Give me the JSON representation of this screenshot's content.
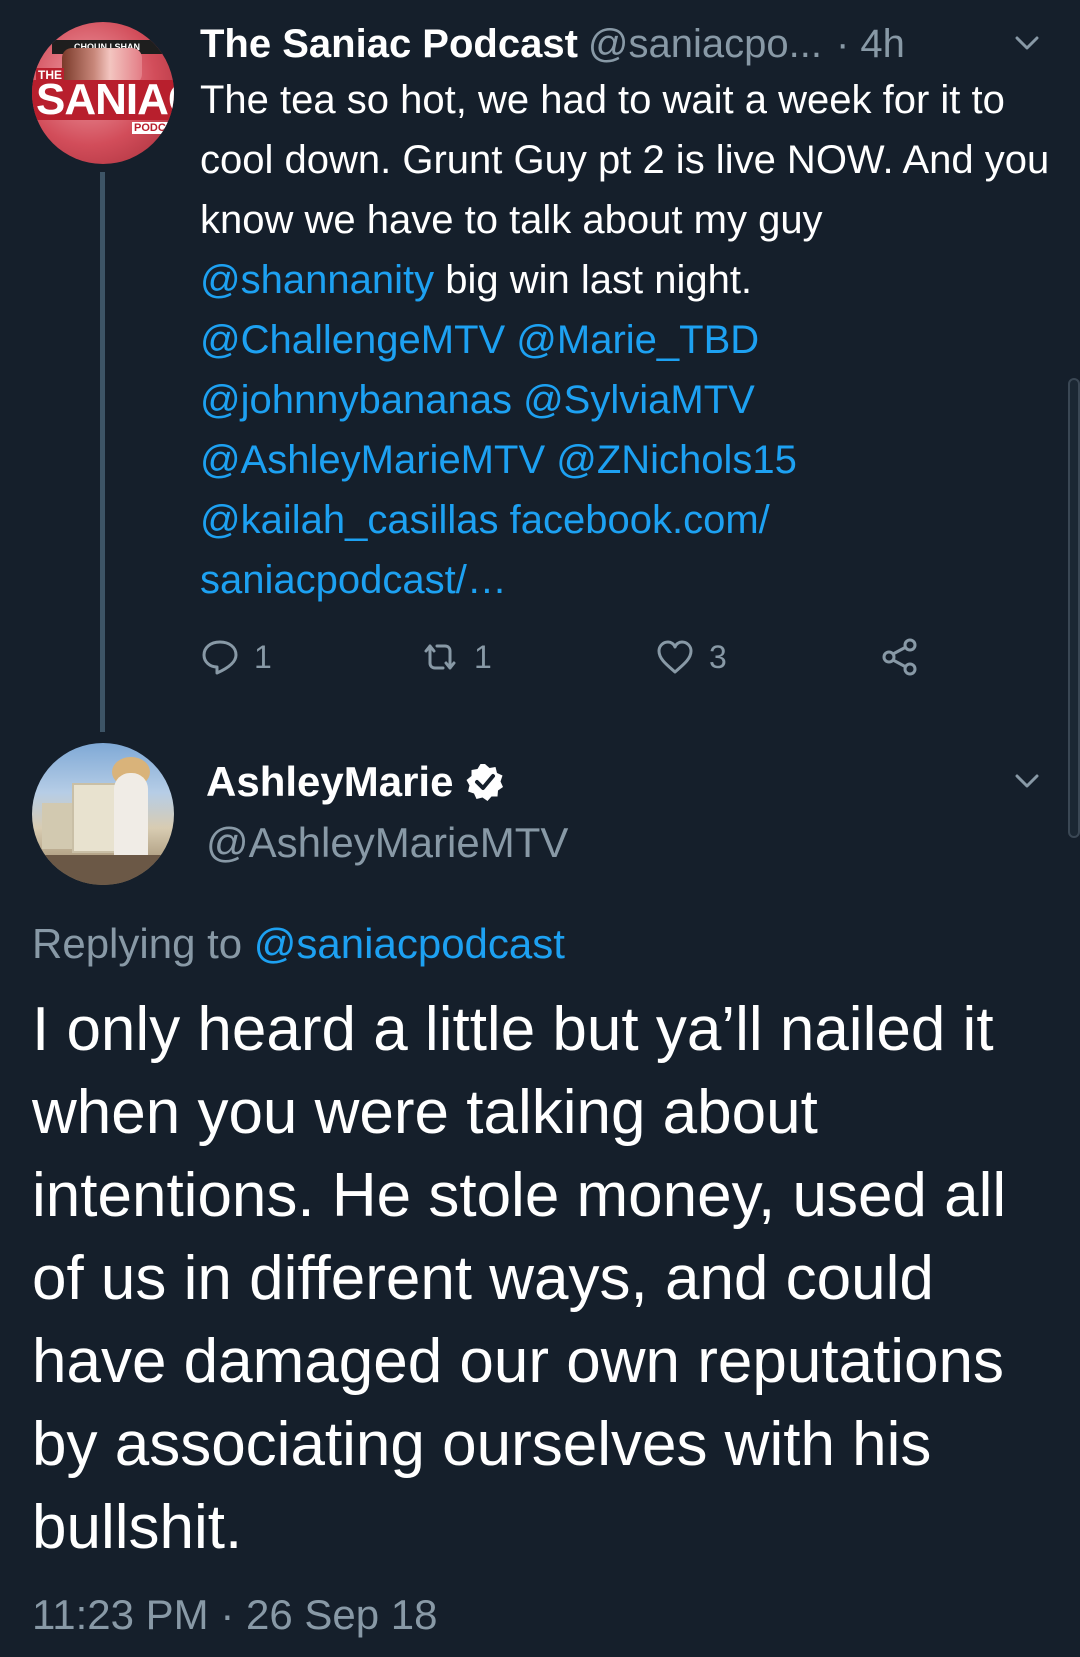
{
  "parent_tweet": {
    "display_name": "The Saniac Podcast",
    "handle": "@saniacpo...",
    "time": "· 4h",
    "avatar_text": {
      "top": "CHOUN | SHAN",
      "label": "THE",
      "brand": "SANIAC",
      "sub": "PODC"
    },
    "text_part1": "The tea so hot, we had to wait a week for it to cool down. Grunt Guy pt 2 is live NOW. And you know we have to talk about my guy ",
    "mention_shannanity": "@shannanity",
    "text_part2": " big win last night. ",
    "mentions_tail": "@ChallengeMTV @Marie_TBD @johnnybananas @SylviaMTV @AshleyMarieMTV @ZNichols15 @kailah_casillas facebook.com/ saniacpodcast/…",
    "actions": {
      "reply_count": "1",
      "retweet_count": "1",
      "like_count": "3"
    }
  },
  "main_tweet": {
    "display_name": "AshleyMarie",
    "handle": "@AshleyMarieMTV",
    "replying_prefix": "Replying to ",
    "replying_to": "@saniacpodcast",
    "body": "I only heard a little but ya’ll nailed it when you were talking about intentions. He stole money, used all of us in different ways, and could have damaged our own reputations by associating ourselves with his bullshit.",
    "timestamp": "11:23 PM · 26 Sep 18"
  },
  "colors": {
    "background": "#151f2b",
    "link": "#1da1f2",
    "secondary_text": "#8899a6",
    "primary_text": "#ffffff"
  },
  "icons": [
    "chevron-down-icon",
    "reply-icon",
    "retweet-icon",
    "like-icon",
    "share-icon",
    "verified-badge-icon"
  ]
}
